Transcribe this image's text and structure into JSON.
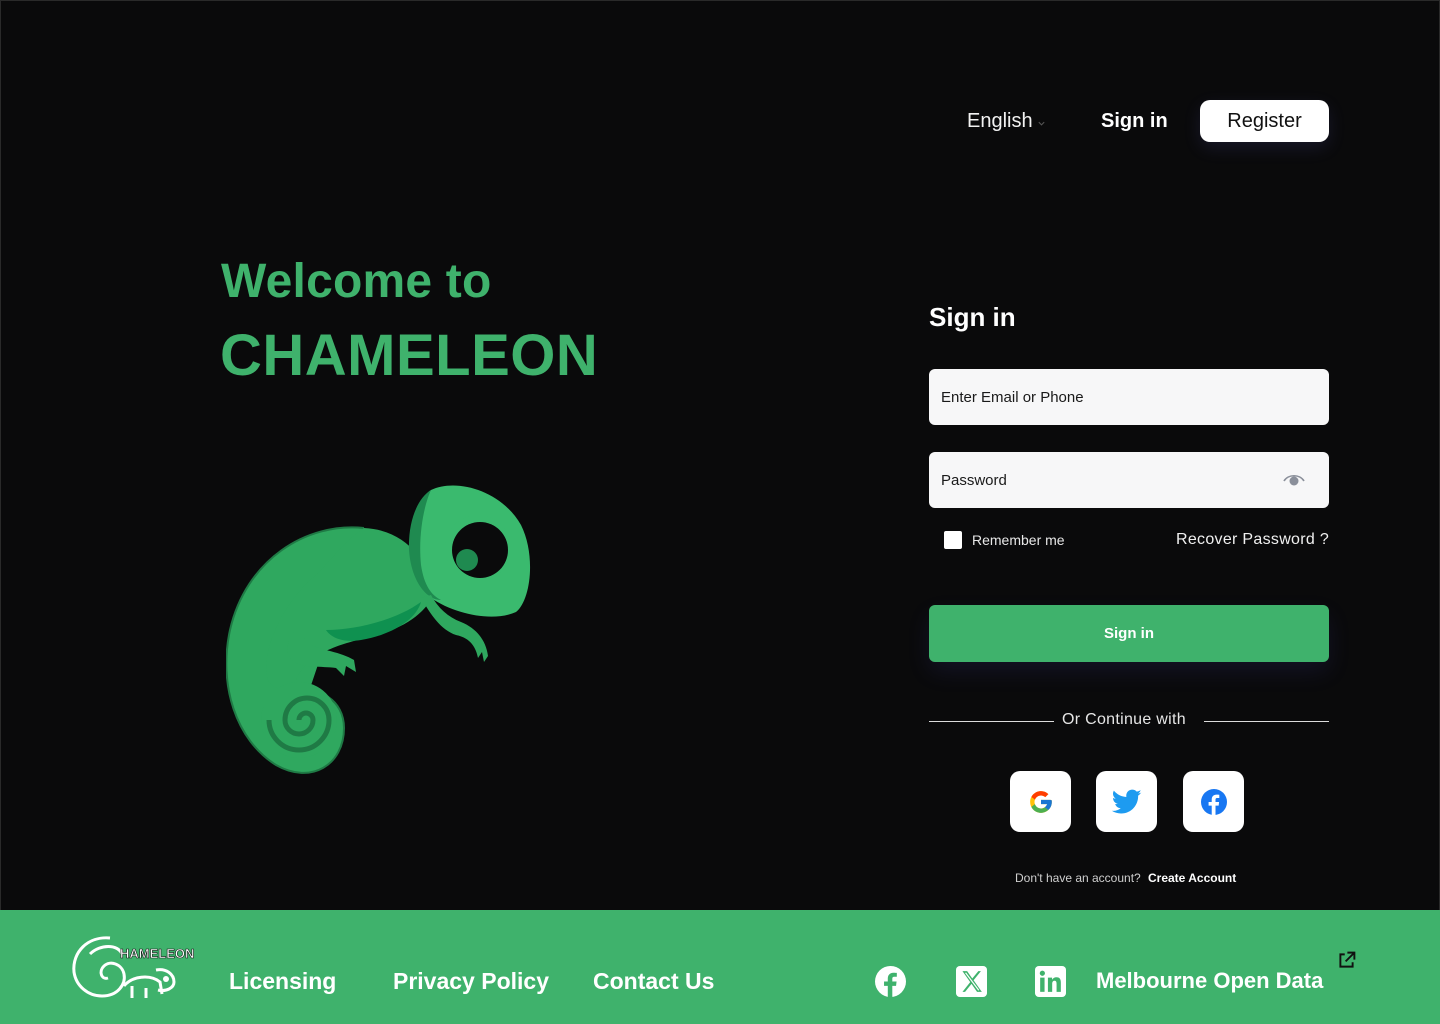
{
  "nav": {
    "language": "English",
    "signin": "Sign in",
    "register": "Register"
  },
  "hero": {
    "line1": "Welcome to",
    "line2": "CHAMELEON"
  },
  "form": {
    "title": "Sign in",
    "email_placeholder": "Enter Email or Phone",
    "password_placeholder": "Password",
    "remember": "Remember me",
    "recover": "Recover Password ?",
    "submit": "Sign in",
    "divider": "Or Continue with",
    "no_account": "Don't have an account?",
    "create_account": "Create Account",
    "social": [
      "google-icon",
      "twitter-icon",
      "facebook-icon"
    ]
  },
  "footer": {
    "logo_text": "HAMELEON",
    "links": [
      "Licensing",
      "Privacy Policy",
      "Contact Us"
    ],
    "social_icons": [
      "facebook-icon",
      "x-icon",
      "linkedin-icon"
    ],
    "open_data": "Melbourne Open Data"
  },
  "colors": {
    "brand": "#3fb26c",
    "background": "#0a0a0b",
    "field": "#f7f7f8"
  }
}
